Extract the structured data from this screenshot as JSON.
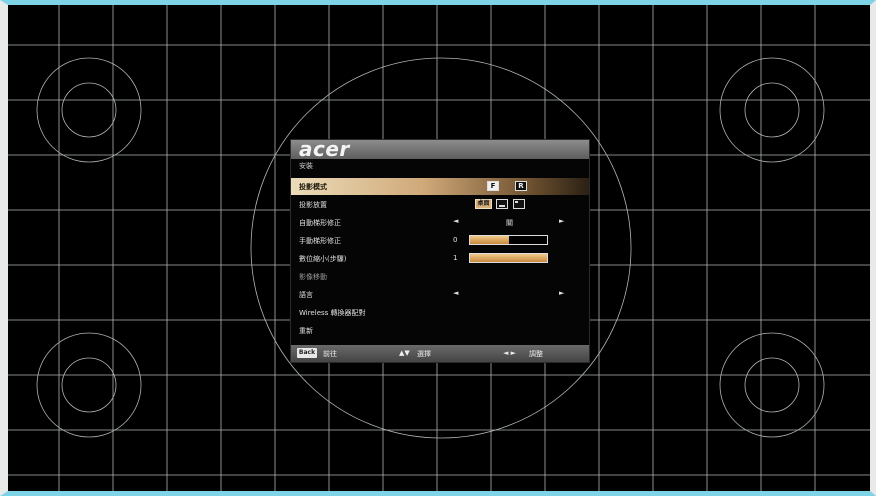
{
  "osd": {
    "brand": "acer",
    "title": "安裝",
    "rows": [
      {
        "label": "投影模式",
        "opt1": "F",
        "opt2": "R"
      },
      {
        "label": "投影放置",
        "opt1": "桌面"
      },
      {
        "label": "自動梯形修正",
        "value": "關",
        "left_arrow": "◄",
        "right_arrow": "►"
      },
      {
        "label": "手動梯形修正",
        "value": "0",
        "level": 0.5
      },
      {
        "label": "數位縮小(步驟)",
        "value": "1",
        "level": 1.0
      },
      {
        "label": "影像移動"
      },
      {
        "label": "語言",
        "left_arrow": "◄",
        "right_arrow": "►"
      },
      {
        "label": "Wireless 轉換器配對"
      },
      {
        "label": "重新"
      }
    ],
    "footer": {
      "back_key": "Back",
      "back_label": "前往",
      "select_keys": "▲▼",
      "select_label": "選擇",
      "adjust_keys": "◄ ►",
      "adjust_label": "調整"
    }
  },
  "colors": {
    "frame_top": "#7fd3e6",
    "frame_side": "#e8eaea",
    "grid_line": "#cfd6d6",
    "highlight": "#cfa878"
  }
}
